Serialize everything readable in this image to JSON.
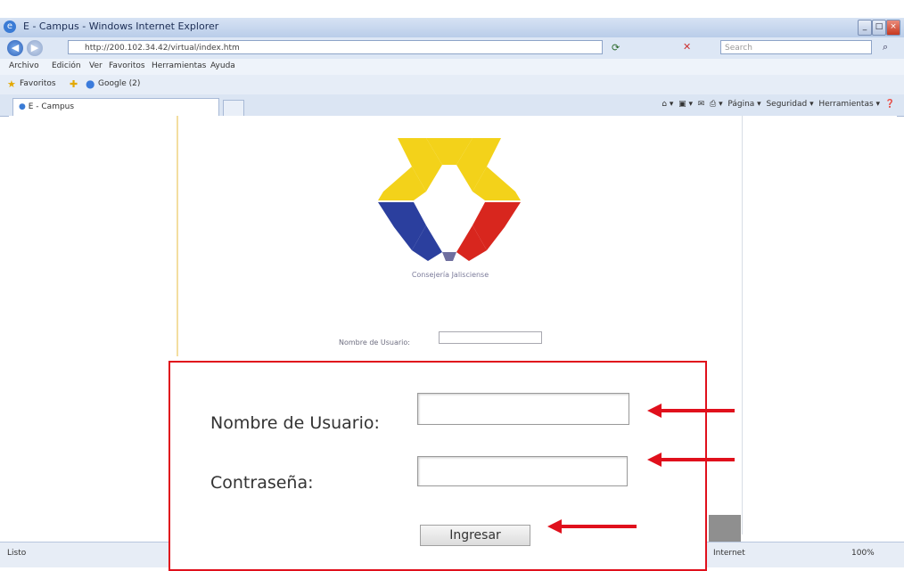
{
  "window": {
    "title": "E - Campus - Windows Internet Explorer",
    "min_glyph": "_",
    "max_glyph": "□",
    "close_glyph": "×"
  },
  "address_bar": {
    "back_glyph": "◀",
    "forward_glyph": "▶",
    "url": "http://200.102.34.42/virtual/index.htm",
    "search_placeholder": "Search"
  },
  "menu": {
    "items": [
      "Archivo",
      "Edición",
      "Ver",
      "Favoritos",
      "Herramientas",
      "Ayuda"
    ]
  },
  "favorites_bar": {
    "favorites_label": "Favoritos",
    "link_label": "Google (2)"
  },
  "tabs": {
    "active_label": "E - Campus"
  },
  "command_bar": {
    "items": [
      "Página ▾",
      "Seguridad ▾",
      "Herramientas ▾"
    ]
  },
  "page": {
    "logo_caption": "Consejería Jalisciense",
    "small_user_label": "Nombre de Usuario:"
  },
  "callout": {
    "user_label": "Nombre de Usuario:",
    "password_label": "Contraseña:",
    "button_label": "Ingresar"
  },
  "status_bar": {
    "left_text": "Listo",
    "zone_text": "Internet",
    "zoom_text": "100%"
  },
  "colors": {
    "callout_border": "#e0101c",
    "arrow": "#e0101c",
    "logo_yellow": "#f3d21a",
    "logo_blue": "#2b3f9e",
    "logo_red": "#d8261e"
  }
}
